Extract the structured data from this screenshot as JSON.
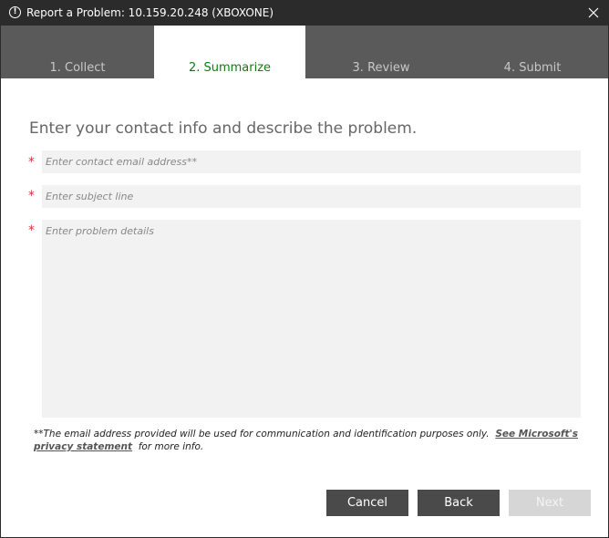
{
  "window": {
    "title": "Report a Problem: 10.159.20.248 (XBOXONE)",
    "title_icon": "!"
  },
  "tabs": [
    {
      "label": "1. Collect",
      "active": false
    },
    {
      "label": "2. Summarize",
      "active": true
    },
    {
      "label": "3. Review",
      "active": false
    },
    {
      "label": "4. Submit",
      "active": false
    }
  ],
  "form": {
    "heading": "Enter your contact info and describe the problem.",
    "required_marker": "*",
    "email": {
      "placeholder": "Enter contact email address**",
      "value": ""
    },
    "subject": {
      "placeholder": "Enter subject line",
      "value": ""
    },
    "details": {
      "placeholder": "Enter problem details",
      "value": ""
    }
  },
  "disclaimer": {
    "text": "**The email address provided will be used for communication and identification purposes only.",
    "link_label": "See Microsoft's privacy statement",
    "suffix": "for more info."
  },
  "buttons": {
    "cancel": "Cancel",
    "back": "Back",
    "next": "Next"
  },
  "colors": {
    "titlebar": "#2b2b2b",
    "tabstrip": "#5a5a5a",
    "active_tab_text": "#107c10",
    "required": "#d13438",
    "button": "#4a4a4a",
    "button_disabled": "#d6d6d6"
  }
}
